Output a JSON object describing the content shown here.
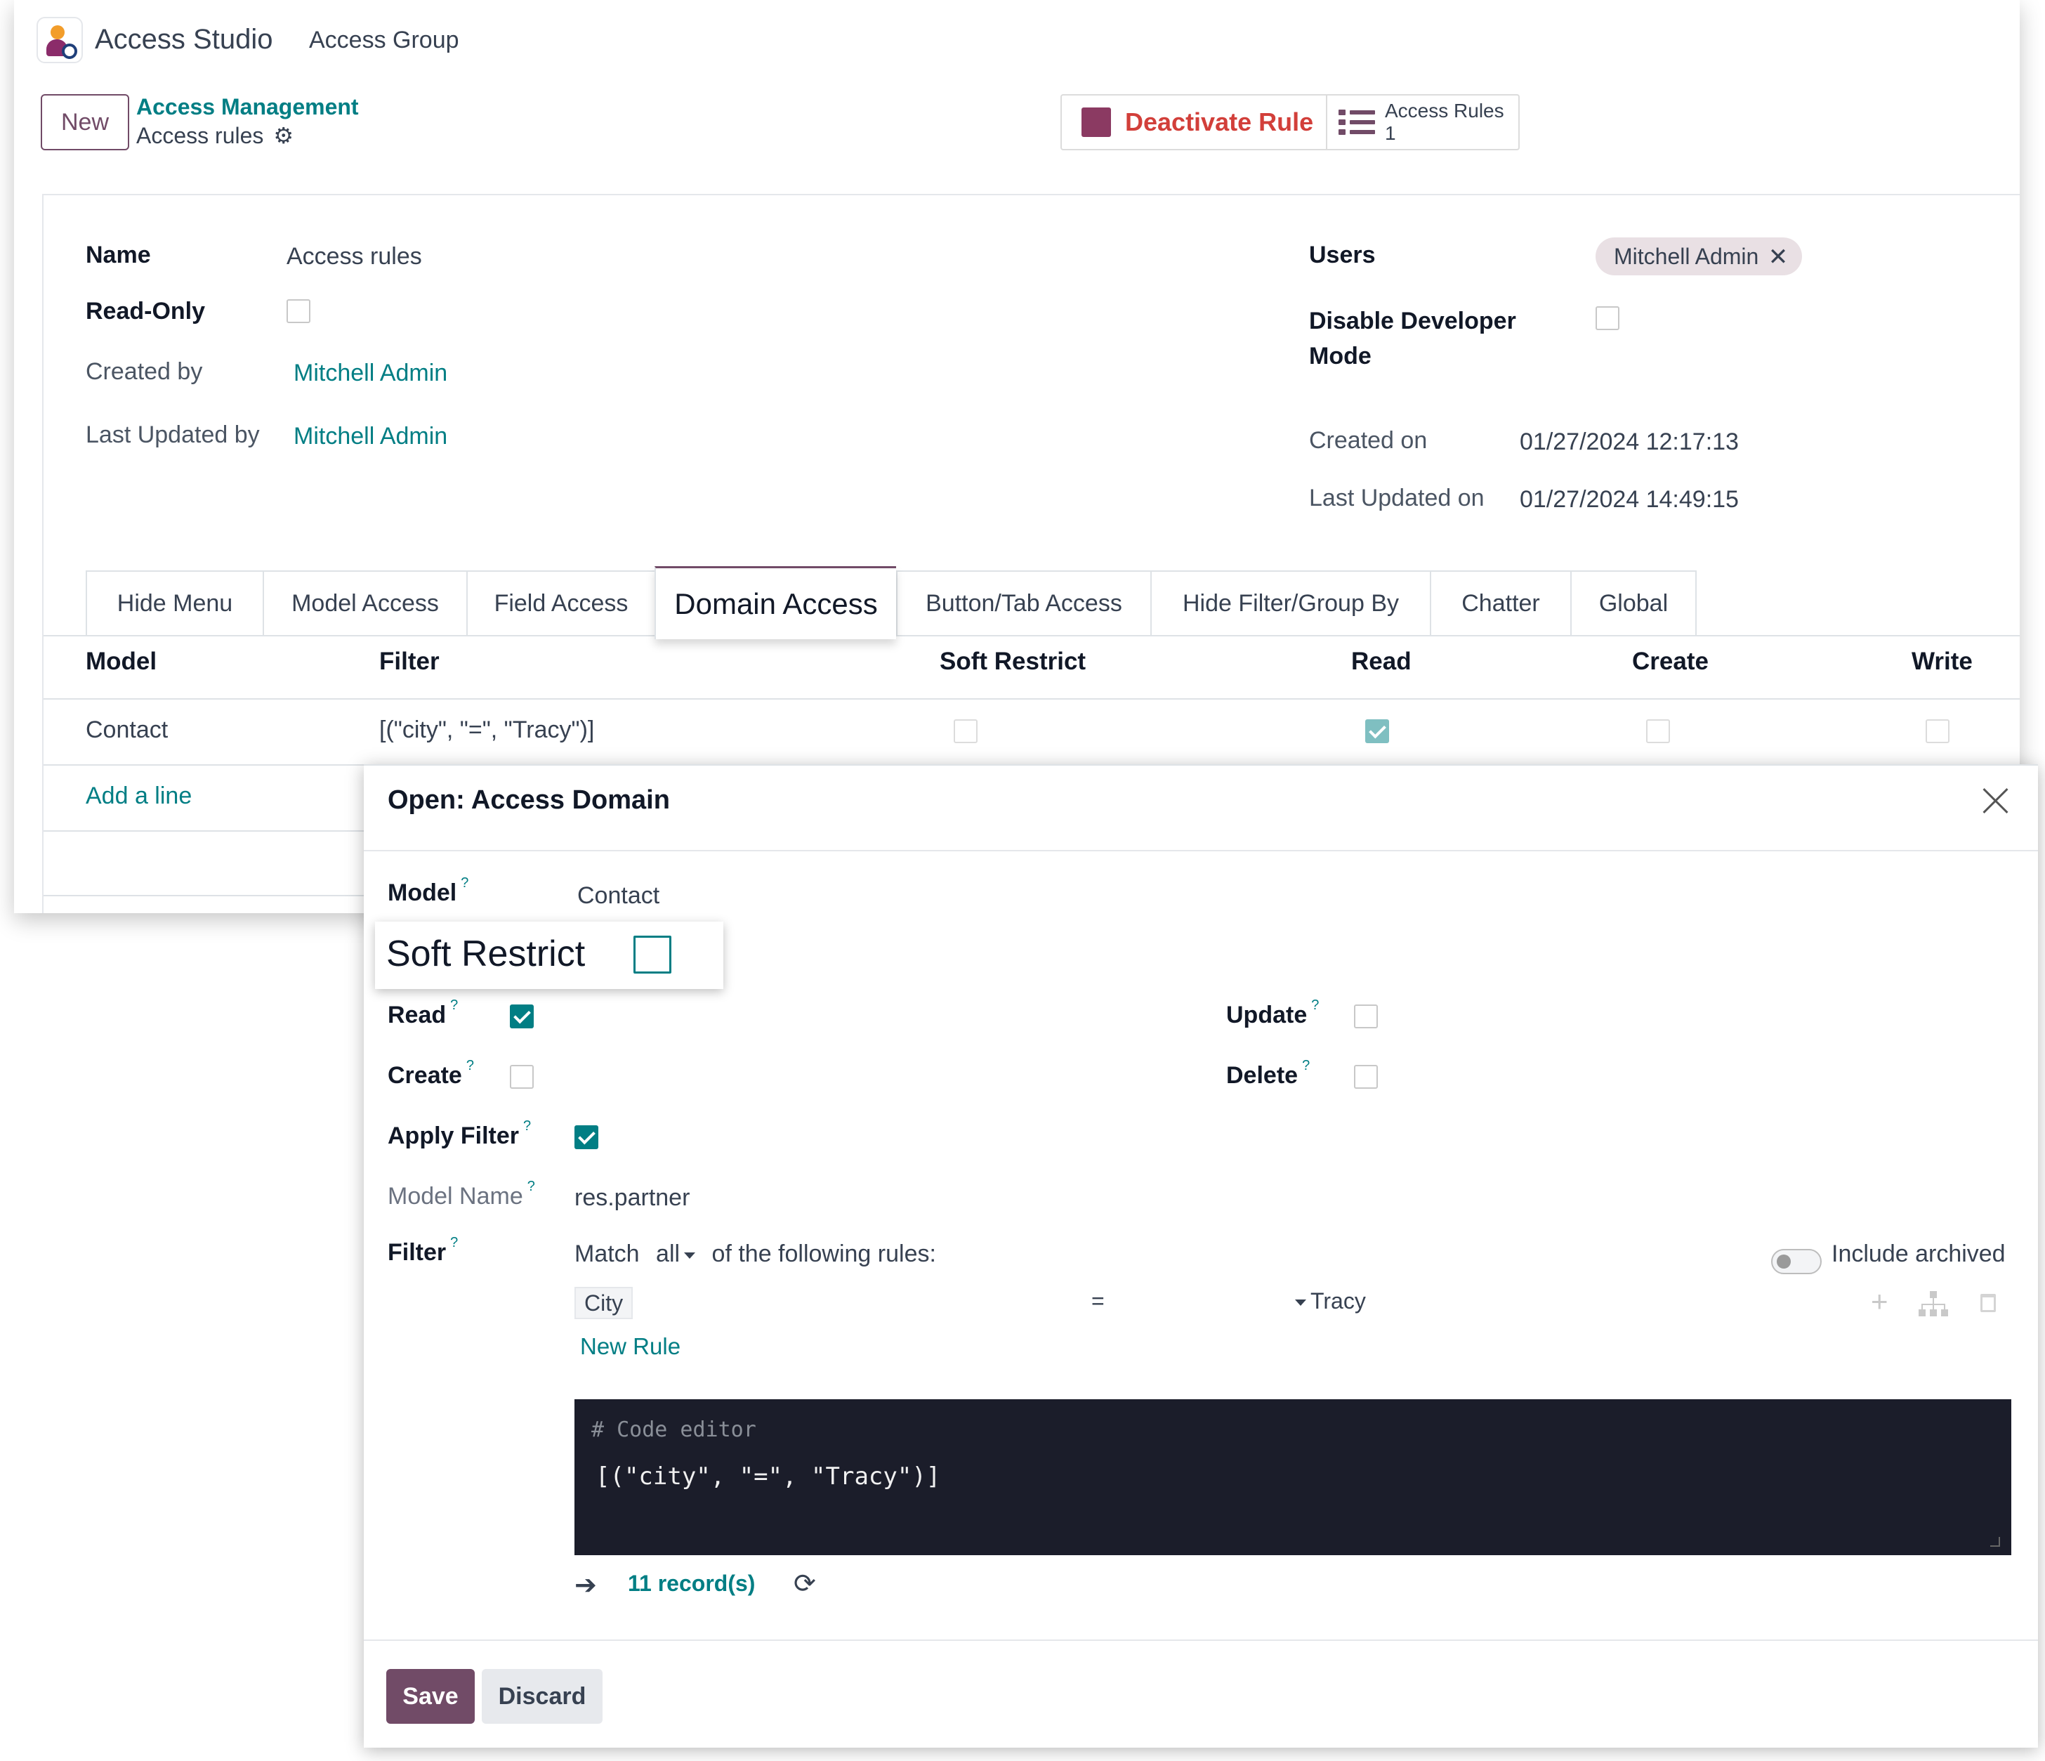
{
  "app": {
    "title": "Access Studio",
    "menu_item": "Access Group"
  },
  "control_panel": {
    "new_label": "New",
    "breadcrumb_parent": "Access Management",
    "breadcrumb_current": "Access rules",
    "deactivate_label": "Deactivate Rule",
    "access_rules_label": "Access Rules",
    "access_rules_count": "1"
  },
  "form": {
    "name_label": "Name",
    "name_value": "Access rules",
    "readonly_label": "Read-Only",
    "readonly_checked": false,
    "created_by_label": "Created by",
    "created_by_value": "Mitchell Admin",
    "updated_by_label": "Last Updated by",
    "updated_by_value": "Mitchell Admin",
    "users_label": "Users",
    "users_tag": "Mitchell Admin",
    "users_tag_remove": "✕",
    "disable_dev_label_1": "Disable Developer",
    "disable_dev_label_2": "Mode",
    "disable_dev_checked": false,
    "created_on_label": "Created on",
    "created_on_value": "01/27/2024 12:17:13",
    "updated_on_label": "Last Updated on",
    "updated_on_value": "01/27/2024 14:49:15"
  },
  "tabs": [
    {
      "label": "Hide Menu",
      "active": false
    },
    {
      "label": "Model Access",
      "active": false
    },
    {
      "label": "Field Access",
      "active": false
    },
    {
      "label": "Domain Access",
      "active": true
    },
    {
      "label": "Button/Tab Access",
      "active": false
    },
    {
      "label": "Hide Filter/Group By",
      "active": false
    },
    {
      "label": "Chatter",
      "active": false
    },
    {
      "label": "Global",
      "active": false
    }
  ],
  "table": {
    "columns": [
      "Model",
      "Filter",
      "Soft Restrict",
      "Read",
      "Create",
      "Write"
    ],
    "rows": [
      {
        "model": "Contact",
        "filter": "[(\"city\", \"=\", \"Tracy\")]",
        "soft_restrict": false,
        "read": true,
        "create": false,
        "write": false
      }
    ],
    "add_line": "Add a line"
  },
  "dialog": {
    "title": "Open: Access Domain",
    "help_marker": "?",
    "model_label": "Model",
    "model_value": "Contact",
    "soft_restrict_label": "Soft Restrict",
    "soft_restrict_checked": false,
    "read_label": "Read",
    "read_checked": true,
    "create_label": "Create",
    "create_checked": false,
    "update_label": "Update",
    "update_checked": false,
    "delete_label": "Delete",
    "delete_checked": false,
    "apply_filter_label": "Apply Filter",
    "apply_filter_checked": true,
    "model_name_label": "Model Name",
    "model_name_value": "res.partner",
    "filter_label": "Filter",
    "match_prefix": "Match",
    "match_value": "all",
    "match_suffix": "of the following rules:",
    "include_archived_label": "Include archived",
    "include_archived_on": false,
    "rule_field": "City",
    "rule_operator": "=",
    "rule_value": "Tracy",
    "new_rule_label": "New Rule",
    "code_comment": "# Code editor",
    "code_value": "[(\"city\", \"=\", \"Tracy\")]",
    "records_label": "11 record(s)",
    "save_label": "Save",
    "discard_label": "Discard"
  },
  "colors": {
    "brand": "#714b67",
    "link": "#017e84",
    "danger": "#d23f3a",
    "code_bg": "#1b1d2a"
  }
}
